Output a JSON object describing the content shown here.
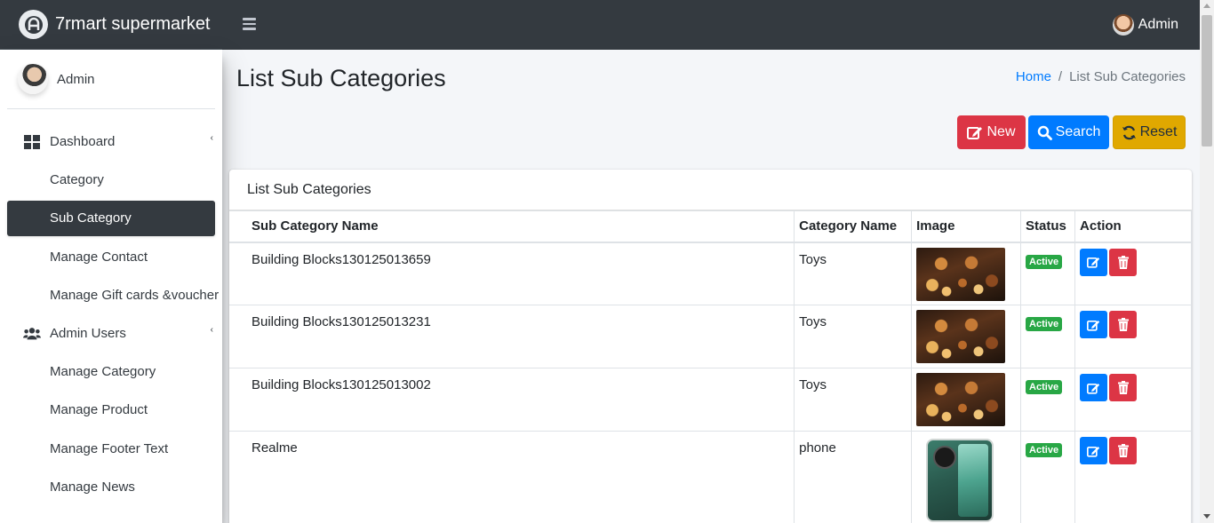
{
  "header": {
    "brand": "7rmart supermarket",
    "user": "Admin"
  },
  "sidebar": {
    "user": "Admin",
    "items": [
      {
        "label": "Dashboard",
        "icon": "dashboard-icon",
        "expandable": true
      },
      {
        "label": "Category"
      },
      {
        "label": "Sub Category",
        "active": true
      },
      {
        "label": "Manage Contact"
      },
      {
        "label": "Manage Gift cards &voucher"
      },
      {
        "label": "Admin Users",
        "icon": "users-icon",
        "expandable": true
      },
      {
        "label": "Manage Category"
      },
      {
        "label": "Manage Product"
      },
      {
        "label": "Manage Footer Text"
      },
      {
        "label": "Manage News"
      }
    ]
  },
  "page": {
    "title": "List Sub Categories",
    "breadcrumb": {
      "home": "Home",
      "separator": "/",
      "current": "List Sub Categories"
    }
  },
  "toolbar": {
    "new_label": "New",
    "search_label": "Search",
    "reset_label": "Reset"
  },
  "card": {
    "title": "List Sub Categories"
  },
  "table": {
    "columns": [
      "Sub Category Name",
      "Category Name",
      "Image",
      "Status",
      "Action"
    ],
    "rows": [
      {
        "name": "Building Blocks130125013659",
        "category": "Toys",
        "image": "food-image",
        "status": "Active"
      },
      {
        "name": "Building Blocks130125013231",
        "category": "Toys",
        "image": "food-image",
        "status": "Active"
      },
      {
        "name": "Building Blocks130125013002",
        "category": "Toys",
        "image": "food-image",
        "status": "Active"
      },
      {
        "name": "Realme",
        "category": "phone",
        "image": "phone-image",
        "status": "Active"
      }
    ]
  },
  "colors": {
    "navbar": "#343a40",
    "danger": "#dc3545",
    "primary": "#007bff",
    "warning": "#e0a800",
    "success": "#28a745"
  }
}
